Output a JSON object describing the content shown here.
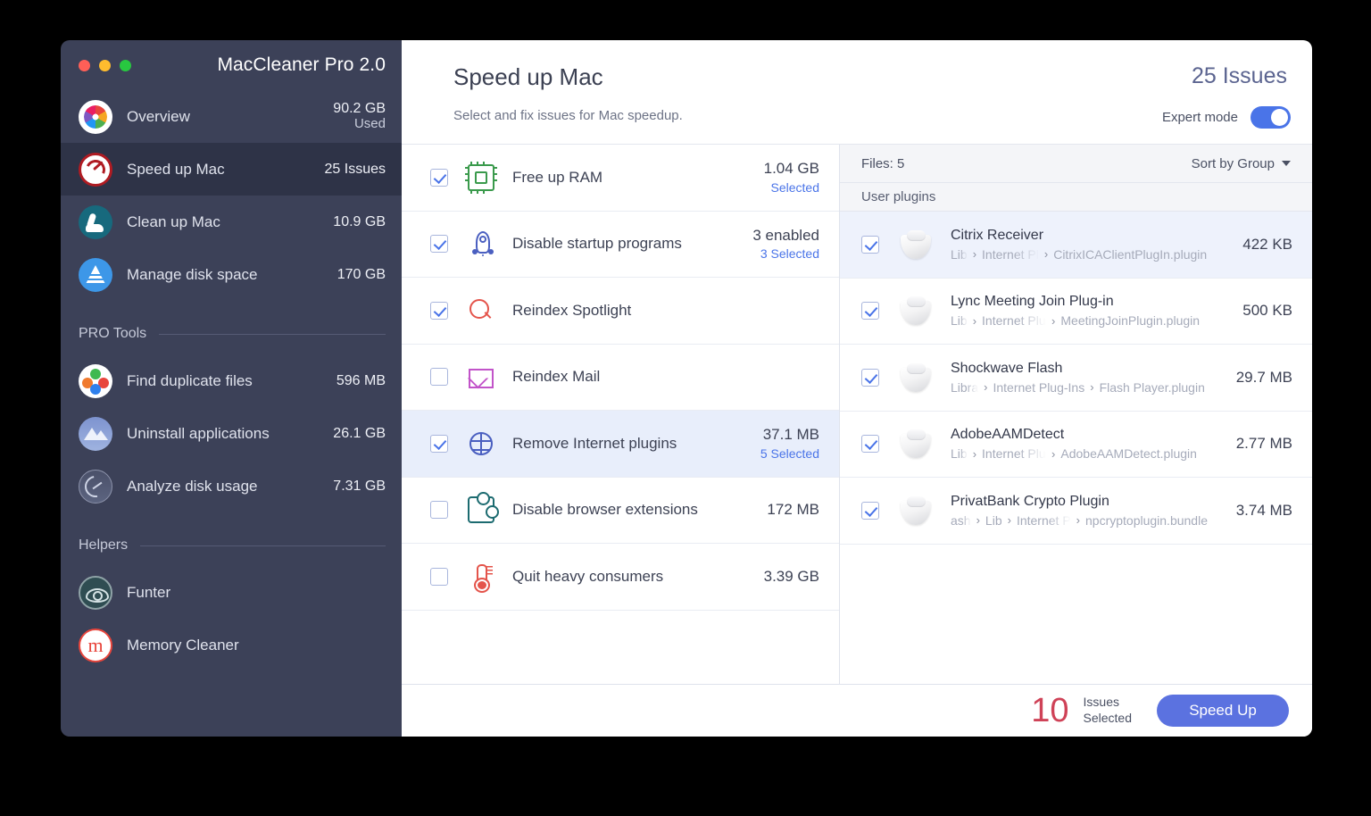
{
  "window": {
    "app_title": "MacCleaner Pro 2.0",
    "traffic_lights": [
      "close",
      "minimize",
      "zoom"
    ]
  },
  "sidebar": {
    "main_items": [
      {
        "label": "Overview",
        "value": "90.2 GB",
        "sub": "Used",
        "icon": "overview-icon",
        "selected": false
      },
      {
        "label": "Speed up Mac",
        "value": "25 Issues",
        "sub": "",
        "icon": "speedometer-icon",
        "selected": true
      },
      {
        "label": "Clean up Mac",
        "value": "10.9 GB",
        "sub": "",
        "icon": "vacuum-icon",
        "selected": false
      },
      {
        "label": "Manage disk space",
        "value": "170 GB",
        "sub": "",
        "icon": "disk-pyramid-icon",
        "selected": false
      }
    ],
    "pro_tools_header": "PRO Tools",
    "pro_tools": [
      {
        "label": "Find duplicate files",
        "value": "596 MB",
        "icon": "duplicate-dots-icon"
      },
      {
        "label": "Uninstall applications",
        "value": "26.1 GB",
        "icon": "mountains-icon"
      },
      {
        "label": "Analyze disk usage",
        "value": "7.31 GB",
        "icon": "gauge-icon"
      }
    ],
    "helpers_header": "Helpers",
    "helpers": [
      {
        "label": "Funter",
        "value": "",
        "icon": "eye-icon"
      },
      {
        "label": "Memory Cleaner",
        "value": "",
        "icon": "memory-m-icon"
      }
    ]
  },
  "header": {
    "title": "Speed up Mac",
    "subtitle": "Select and fix issues for Mac speedup.",
    "issues": "25 Issues",
    "expert_mode_label": "Expert mode",
    "expert_mode_on": true
  },
  "issues": {
    "rows": [
      {
        "checked": true,
        "name": "Free up RAM",
        "value": "1.04 GB",
        "selected_text": "Selected",
        "icon": "cpu-chip-icon",
        "active": false
      },
      {
        "checked": true,
        "name": "Disable startup programs",
        "value": "3 enabled",
        "selected_text": "3 Selected",
        "icon": "rocket-icon",
        "active": false
      },
      {
        "checked": true,
        "name": "Reindex Spotlight",
        "value": "",
        "selected_text": "",
        "icon": "magnifier-icon",
        "active": false
      },
      {
        "checked": false,
        "name": "Reindex Mail",
        "value": "",
        "selected_text": "",
        "icon": "envelope-icon",
        "active": false
      },
      {
        "checked": true,
        "name": "Remove Internet plugins",
        "value": "37.1 MB",
        "selected_text": "5 Selected",
        "icon": "globe-icon",
        "active": true
      },
      {
        "checked": false,
        "name": "Disable browser extensions",
        "value": "172 MB",
        "selected_text": "",
        "icon": "puzzle-icon",
        "active": false
      },
      {
        "checked": false,
        "name": "Quit heavy consumers",
        "value": "3.39 GB",
        "selected_text": "",
        "icon": "thermometer-icon",
        "active": false
      }
    ]
  },
  "files": {
    "count_label": "Files: 5",
    "sort_label": "Sort by Group",
    "group_label": "User plugins",
    "rows": [
      {
        "checked": true,
        "name": "Citrix Receiver",
        "size": "422 KB",
        "active": true,
        "crumbs": [
          "Lib",
          "Internet Pl",
          "CitrixICAClientPlugIn.plugin"
        ],
        "icon": "plugin-bundle-icon"
      },
      {
        "checked": true,
        "name": "Lync Meeting Join Plug-in",
        "size": "500 KB",
        "active": false,
        "crumbs": [
          "Lib",
          "Internet Plug",
          "MeetingJoinPlugin.plugin"
        ],
        "icon": "plugin-bundle-icon"
      },
      {
        "checked": true,
        "name": "Shockwave Flash",
        "size": "29.7 MB",
        "active": false,
        "crumbs": [
          "Libra",
          "Internet Plug-Ins",
          "Flash Player.plugin"
        ],
        "icon": "plugin-bundle-icon"
      },
      {
        "checked": true,
        "name": "AdobeAAMDetect",
        "size": "2.77 MB",
        "active": false,
        "crumbs": [
          "Lib",
          "Internet Plug",
          "AdobeAAMDetect.plugin"
        ],
        "icon": "plugin-bundle-icon"
      },
      {
        "checked": true,
        "name": "PrivatBank Crypto Plugin",
        "size": "3.74 MB",
        "active": false,
        "crumbs": [
          "ash",
          "Lib",
          "Internet P",
          "npcryptoplugin.bundle"
        ],
        "icon": "plugin-bundle-icon"
      }
    ]
  },
  "footer": {
    "selected_count": "10",
    "selected_line1": "Issues",
    "selected_line2": "Selected",
    "action_label": "Speed Up"
  },
  "colors": {
    "sidebar_bg": "#3c4158",
    "sidebar_selected": "#2e3347",
    "accent_blue": "#4a74e8",
    "button_blue": "#5b72e0",
    "issue_count_blue": "#5b6490",
    "count_red": "#cf4257",
    "row_highlight": "#e8eefb"
  }
}
